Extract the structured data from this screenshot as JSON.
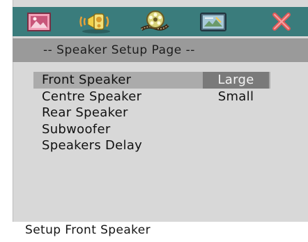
{
  "tabs": [
    {
      "icon": "picture-icon"
    },
    {
      "icon": "speaker-audio-icon"
    },
    {
      "icon": "film-reel-icon"
    },
    {
      "icon": "preference-panel-icon"
    },
    {
      "icon": "close-x-icon"
    }
  ],
  "page_title": "-- Speaker Setup Page --",
  "menu": {
    "items": [
      {
        "label": "Front Speaker",
        "selected": true
      },
      {
        "label": "Centre Speaker",
        "selected": false
      },
      {
        "label": "Rear Speaker",
        "selected": false
      },
      {
        "label": "Subwoofer",
        "selected": false
      },
      {
        "label": "Speakers Delay",
        "selected": false
      }
    ]
  },
  "options": {
    "values": [
      {
        "label": "Large",
        "current": true
      },
      {
        "label": "Small",
        "current": false
      }
    ]
  },
  "status": "Setup Front Speaker",
  "colors": {
    "tabbar": "#3a7c7c",
    "panel": "#d8d8d8",
    "title_band": "#9a9a9a",
    "selected_row": "#ababab",
    "current_value": "#7a7a7a",
    "close_icon": "#e25a5a"
  }
}
